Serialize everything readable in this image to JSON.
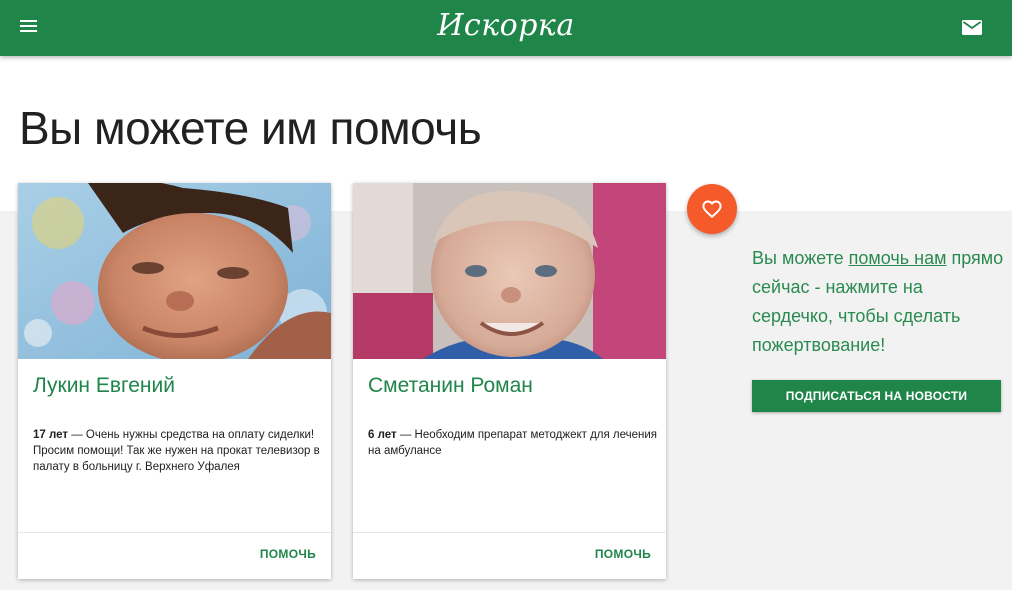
{
  "header": {
    "logo_text": "Искорка",
    "menu_icon": "menu-icon",
    "mail_icon": "mail-icon",
    "bar_color": "#1f8549"
  },
  "page": {
    "title": "Вы можете им помочь"
  },
  "cards": [
    {
      "name": "Лукин Евгений",
      "age": "17 лет",
      "description": " — Очень нужны средства на оплату сиделки! Просим помощи! Так же нужен на прокат телевизор в палату в больницу г. Верхнего Уфалея",
      "action_label": "ПОМОЧЬ"
    },
    {
      "name": "Сметанин Роман",
      "age": "6 лет",
      "description": " — Необходим препарат методжект для лечения на амбулансе",
      "action_label": "ПОМОЧЬ"
    }
  ],
  "donate_fab": {
    "icon": "heart-icon",
    "color": "#f55a2a"
  },
  "sidebar": {
    "text_before": "Вы можете ",
    "link_text": "помочь нам",
    "text_after": " прямо сейчас - нажмите на сердечко, чтобы сделать пожертвование!",
    "subscribe_label": "ПОДПИСАТЬСЯ НА НОВОСТИ"
  }
}
